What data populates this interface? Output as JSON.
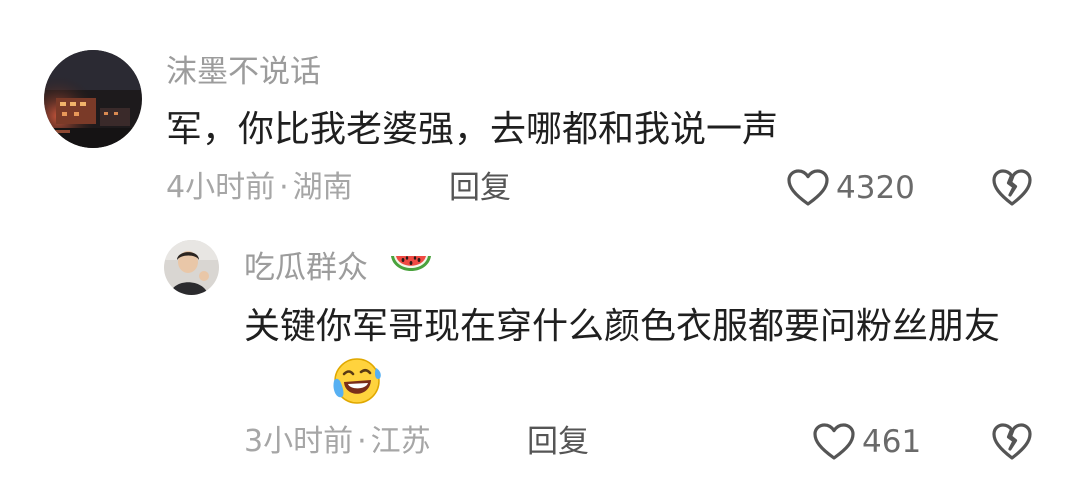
{
  "comment": {
    "username": "沫墨不说话",
    "text": "军，你比我老婆强，去哪都和我说一声",
    "time": "4小时前",
    "separator": "·",
    "location": "湖南",
    "reply_label": "回复",
    "like_count": "4320",
    "icons": {
      "avatar": "night-city-avatar",
      "like": "heart-outline-icon",
      "dislike": "broken-heart-icon"
    }
  },
  "reply": {
    "username": "吃瓜群众",
    "username_emoji": "watermelon-icon",
    "text": "关键你军哥现在穿什么颜色衣服都要问粉丝朋友",
    "text_emoji": "laughing-crying-emoji",
    "time": "3小时前",
    "separator": "·",
    "location": "江苏",
    "reply_label": "回复",
    "like_count": "461",
    "icons": {
      "avatar": "child-photo-avatar",
      "like": "heart-outline-icon",
      "dislike": "broken-heart-icon"
    }
  },
  "colors": {
    "text_primary": "#1f1f1f",
    "text_secondary": "#9c9c9c",
    "reply_label": "#555555",
    "background": "#ffffff"
  }
}
